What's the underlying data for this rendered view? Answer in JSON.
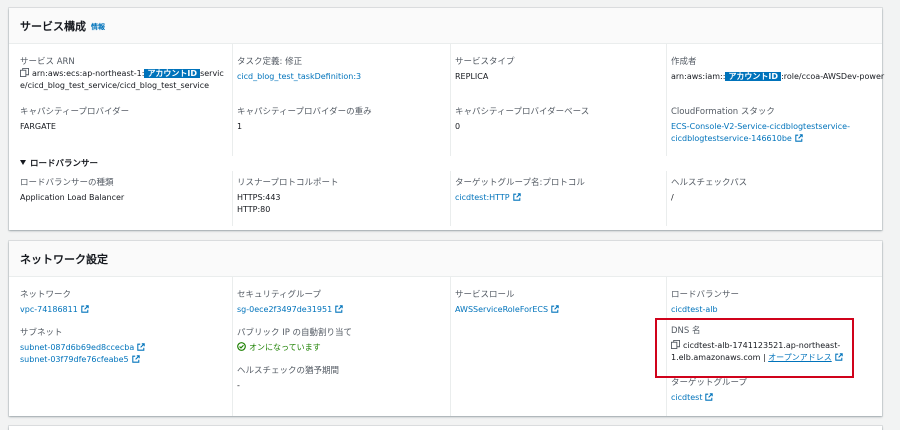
{
  "service_panel": {
    "title": "サービス構成",
    "info": "情報",
    "fields": {
      "arn_label": "サービス ARN",
      "arn_prefix": "arn:aws:ecs:ap-northeast-1:",
      "arn_mask": "アカウントID",
      "arn_suffix1": "servic",
      "arn_suffix2": "e/cicd_blog_test_service/cicd_blog_test_service",
      "taskdef_label": "タスク定義: 修正",
      "taskdef_value": "cicd_blog_test_taskDefinition:3",
      "svctype_label": "サービスタイプ",
      "svctype_value": "REPLICA",
      "creator_label": "作成者",
      "creator_prefix": "arn:aws:iam::",
      "creator_mask": "アカウントID",
      "creator_suffix": ":role/ccoa-AWSDev-power",
      "capacity_label": "キャパシティープロバイダー",
      "capacity_value": "FARGATE",
      "weight_label": "キャパシティープロバイダーの重み",
      "weight_value": "1",
      "base_label": "キャパシティープロバイダーベース",
      "base_value": "0",
      "cfn_label": "CloudFormation スタック",
      "cfn_line1": "ECS-Console-V2-Service-cicdblogtestservice-",
      "cfn_line2": "cicdblogtestservice-146610be"
    },
    "lb_section": {
      "title": "ロードバランサー",
      "type_label": "ロードバランサーの種類",
      "type_value": "Application Load Balancer",
      "listener_label": "リスナープロトコルポート",
      "listener_value1": "HTTPS:443",
      "listener_value2": "HTTP:80",
      "tg_label": "ターゲットグループ名:プロトコル",
      "tg_value": "cicdtest:HTTP",
      "health_label": "ヘルスチェックパス",
      "health_value": "/"
    }
  },
  "network_panel": {
    "title": "ネットワーク設定",
    "network_label": "ネットワーク",
    "network_value": "vpc-74186811",
    "subnet_label": "サブネット",
    "subnets": [
      "subnet-087d6b69ed8ccecba",
      "subnet-03f79dfe76cfeabe5"
    ],
    "sg_label": "セキュリティグループ",
    "sg_value": "sg-0ece2f3497de31951",
    "publicip_label": "パブリック IP の自動割り当て",
    "publicip_value": "オンになっています",
    "grace_label": "ヘルスチェックの猶予期間",
    "grace_value": "-",
    "role_label": "サービスロール",
    "role_value": "AWSServiceRoleForECS",
    "lb_label": "ロードバランサー",
    "lb_value": "cicdtest-alb",
    "dns_label": "DNS 名",
    "dns_line1": "cicdtest-alb-1741123521.ap-northeast-",
    "dns_line2": "1.elb.amazonaws.com",
    "dns_sep": " | ",
    "dns_open": "オープンアドレス",
    "tg_label": "ターゲットグループ",
    "tg_value": "cicdtest"
  },
  "colors": {
    "link": "#0073bb",
    "success": "#1d8102",
    "highlight": "#d0021b"
  }
}
